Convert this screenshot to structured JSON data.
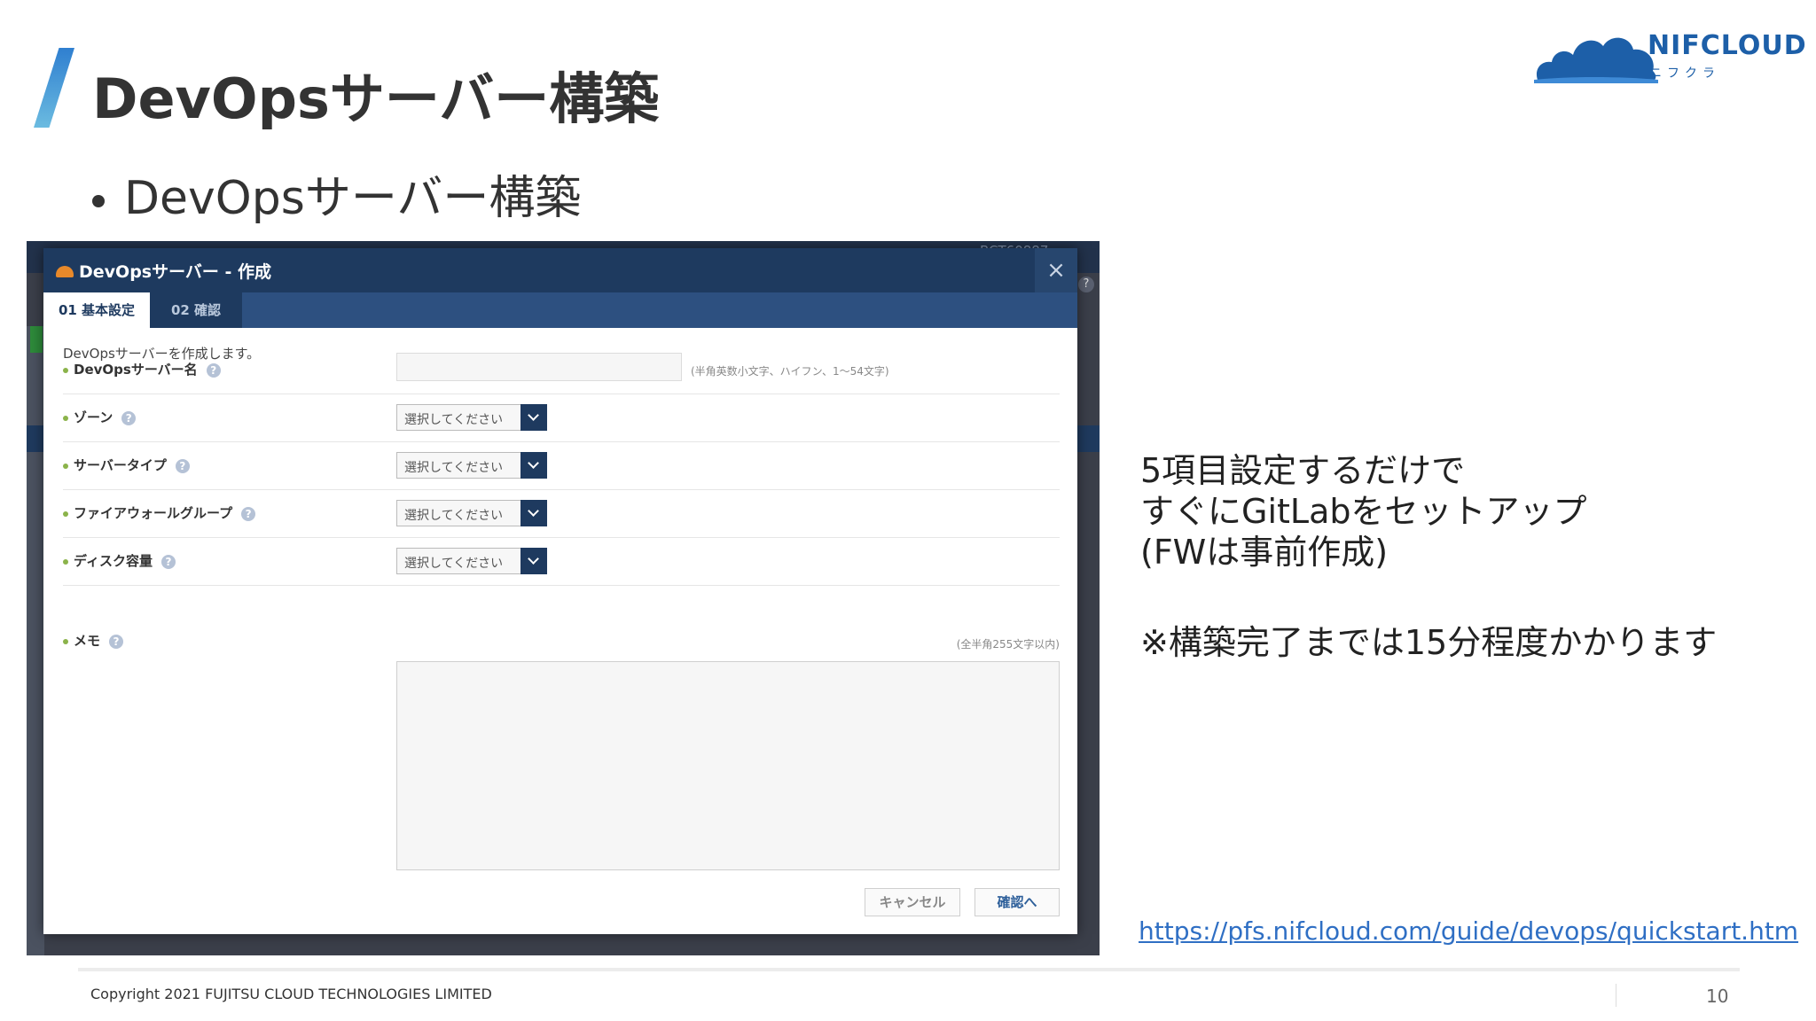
{
  "slide": {
    "title": "DevOpsサーバー構築",
    "bullet": "DevOpsサーバー構築",
    "logo_name": "NIFCLOUD",
    "logo_sub": "ニフクラ",
    "note_lines": [
      "5項目設定するだけで",
      "すぐにGitLabをセットアップ",
      "(FWは事前作成)"
    ],
    "note_time": "※構築完了までは15分程度かかります",
    "link": "https://pfs.nifcloud.com/guide/devops/quickstart.htm",
    "copyright": "Copyright 2021 FUJITSU CLOUD TECHNOLOGIES LIMITED",
    "page_number": "10",
    "colors": {
      "accent": "#1d5fa8",
      "slash_top": "#2f7fd0",
      "slash_bottom": "#6bbbe0"
    }
  },
  "screenshot": {
    "background_id": "BCT60887",
    "modal": {
      "title": "DevOpsサーバー - 作成",
      "close_icon": "×",
      "tabs": [
        {
          "label": "01 基本設定",
          "active": true
        },
        {
          "label": "02 確認",
          "active": false
        }
      ],
      "intro": "DevOpsサーバーを作成します。",
      "fields": {
        "name": {
          "label": "DevOpsサーバー名",
          "value": "",
          "hint": "(半角英数小文字、ハイフン、1〜54文字)"
        },
        "zone": {
          "label": "ゾーン",
          "selected": "選択してください"
        },
        "server_type": {
          "label": "サーバータイプ",
          "selected": "選択してください"
        },
        "firewall": {
          "label": "ファイアウォールグループ",
          "selected": "選択してください"
        },
        "disk": {
          "label": "ディスク容量",
          "selected": "選択してください"
        },
        "memo": {
          "label": "メモ",
          "hint": "(全半角255文字以内)",
          "value": ""
        }
      },
      "help_icon": "?",
      "buttons": {
        "cancel": "キャンセル",
        "confirm": "確認へ"
      },
      "colors": {
        "header": "#1e3a5f",
        "tabbar": "#2d5080",
        "required_dot": "#8bb34a"
      }
    }
  }
}
